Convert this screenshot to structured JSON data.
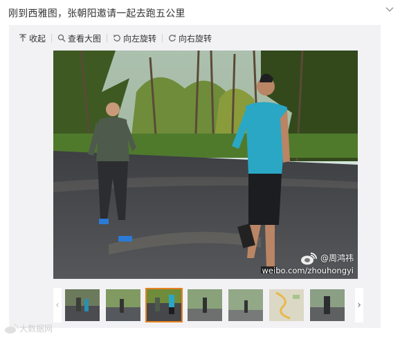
{
  "post": {
    "text": "刚到西雅图，张朝阳邀请一起去跑五公里"
  },
  "toolbar": {
    "collapse_label": "收起",
    "view_large_label": "查看大图",
    "rotate_left_label": "向左旋转",
    "rotate_right_label": "向右旋转"
  },
  "photo": {
    "watermark_handle": "@周鸿祎",
    "watermark_url": "weibo.com/zhouhongyi"
  },
  "thumbnails": {
    "count": 7,
    "active_index": 2
  },
  "footer": {
    "watermark": "大数据网"
  },
  "colors": {
    "active_border": "#e8801e",
    "panel_bg": "#f2f2f5"
  }
}
